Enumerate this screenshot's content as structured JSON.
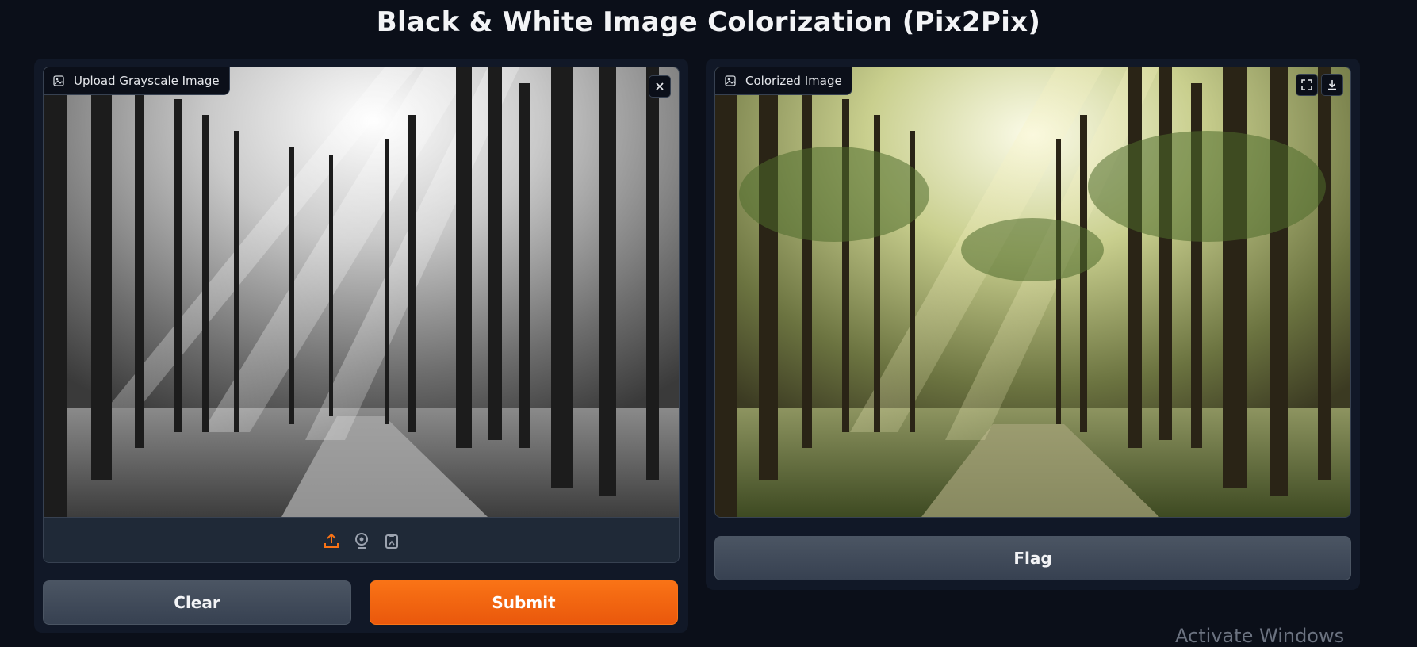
{
  "page": {
    "title": "Black & White Image Colorization (Pix2Pix)"
  },
  "input_panel": {
    "label": "Upload Grayscale Image",
    "image_alt": "Grayscale forest photo with sunbeams through trees and a dirt path",
    "icons": [
      "image-icon",
      "close-icon",
      "upload-icon",
      "webcam-icon",
      "clipboard-icon"
    ],
    "clear_label": "Clear",
    "submit_label": "Submit"
  },
  "output_panel": {
    "label": "Colorized Image",
    "image_alt": "Colorized forest photo with sunbeams, green foliage and a dirt path",
    "icons": [
      "image-icon",
      "fullscreen-icon",
      "download-icon"
    ],
    "flag_label": "Flag"
  },
  "watermark": {
    "text": "Activate Windows"
  },
  "colors": {
    "background": "#0b0f19",
    "panel": "#111827",
    "block": "#1f2937",
    "border": "#374151",
    "accent": "#f97316",
    "secondary_button": "#4b5563"
  }
}
